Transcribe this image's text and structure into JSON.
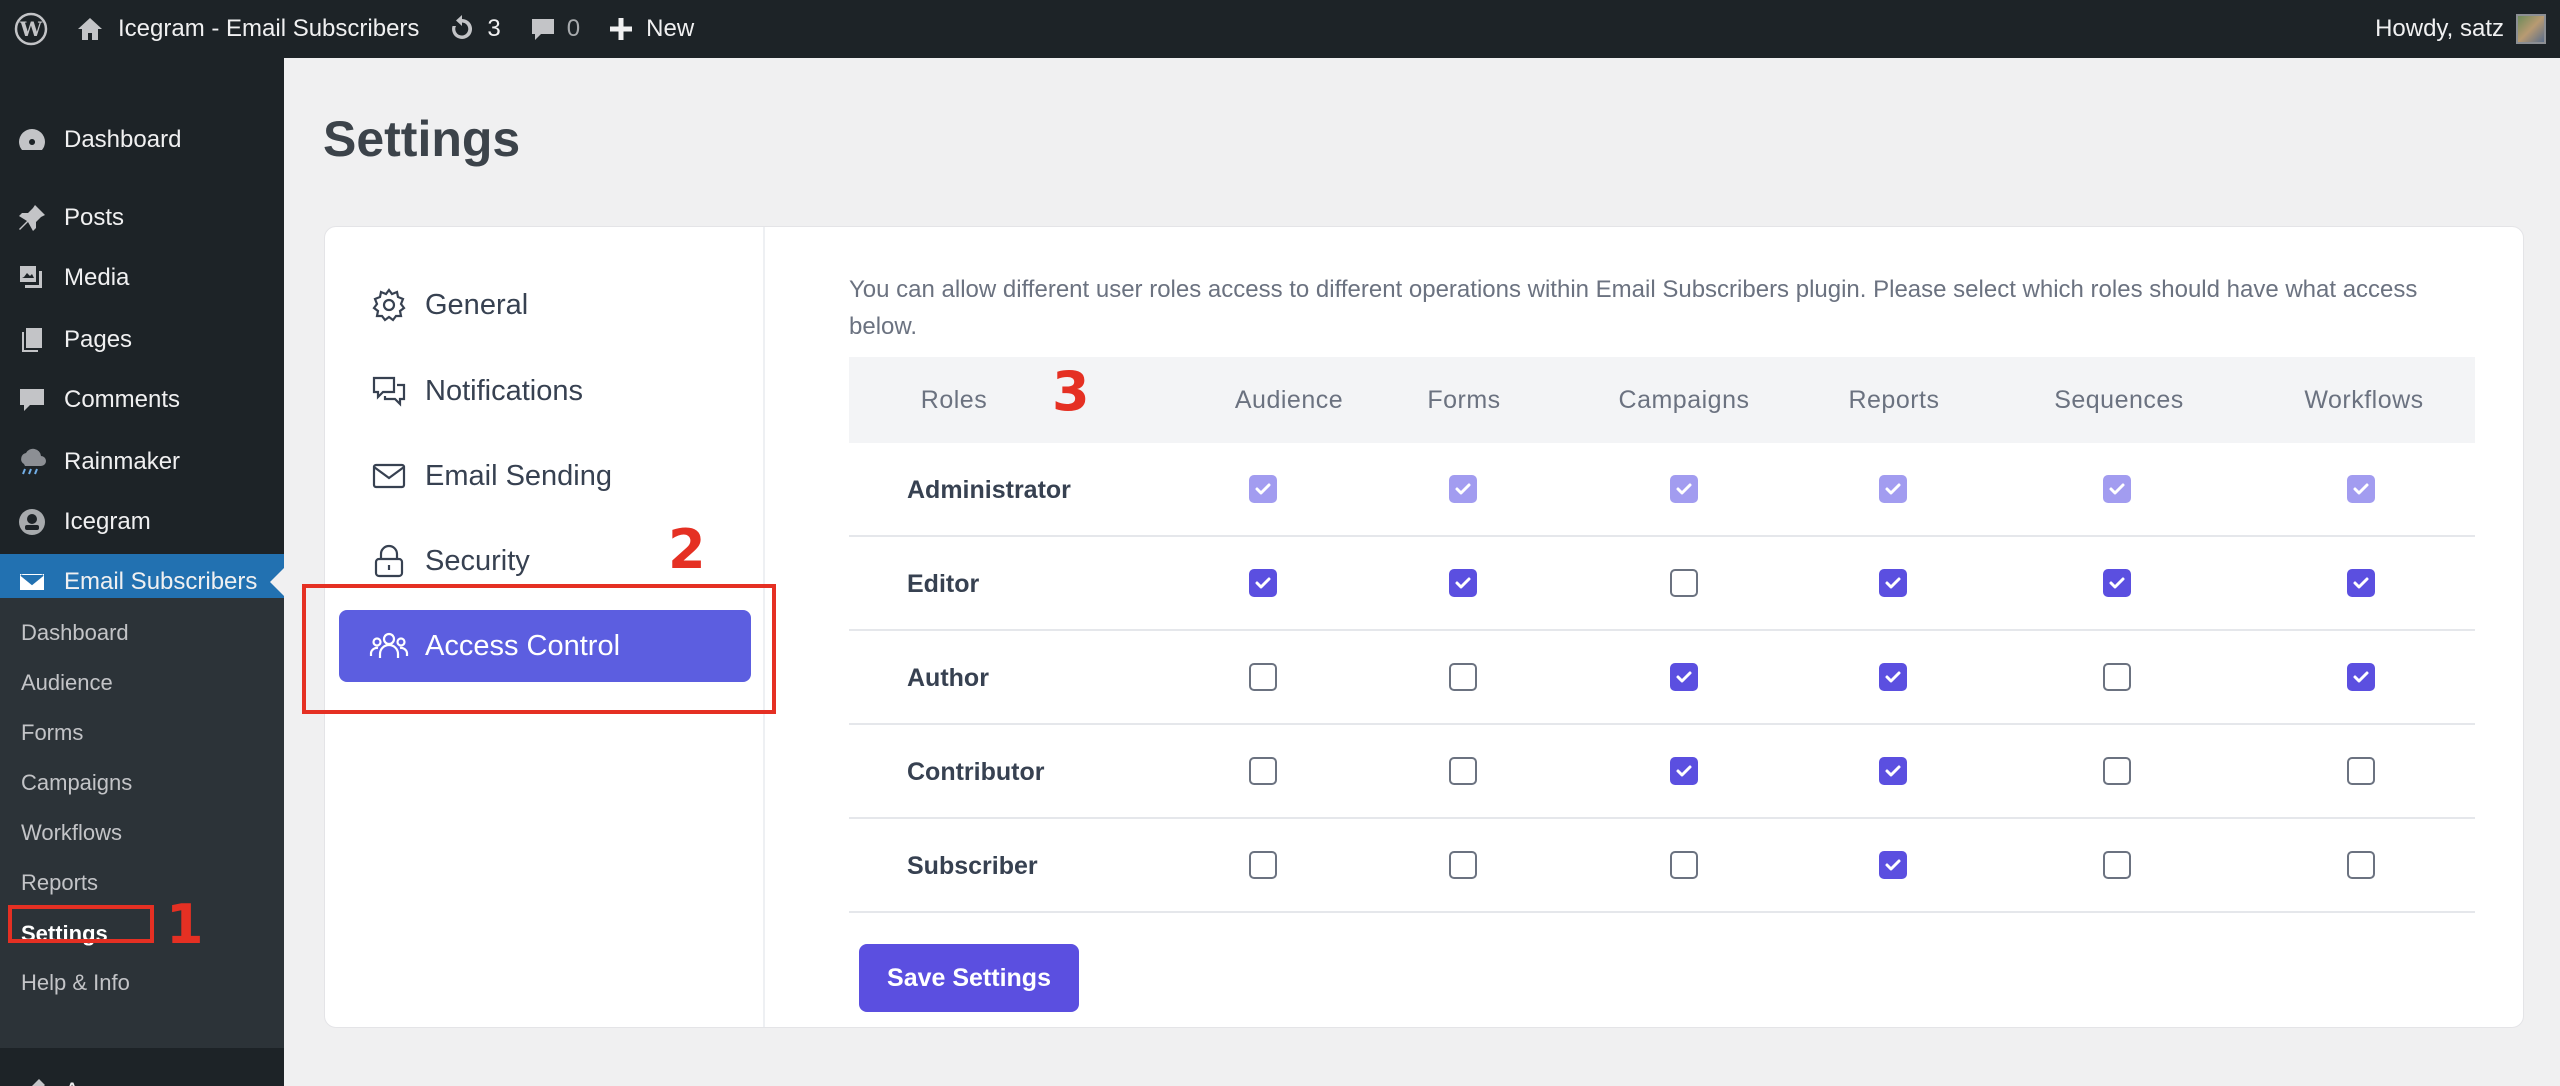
{
  "adminbar": {
    "site_name": "Icegram - Email Subscribers",
    "updates_count": "3",
    "comments_count": "0",
    "new_label": "New",
    "howdy": "Howdy, satz"
  },
  "sidebar": {
    "items": [
      {
        "label": "Dashboard",
        "icon": "dashboard-icon"
      },
      {
        "label": "Posts",
        "icon": "pin-icon"
      },
      {
        "label": "Media",
        "icon": "media-icon"
      },
      {
        "label": "Pages",
        "icon": "pages-icon"
      },
      {
        "label": "Comments",
        "icon": "comment-icon"
      },
      {
        "label": "Rainmaker",
        "icon": "cloud-icon"
      },
      {
        "label": "Icegram",
        "icon": "icegram-icon"
      },
      {
        "label": "Email Subscribers",
        "icon": "envelope-icon"
      }
    ],
    "submenu": [
      "Dashboard",
      "Audience",
      "Forms",
      "Campaigns",
      "Workflows",
      "Reports",
      "Settings",
      "Help & Info"
    ],
    "appearance": "Appearance"
  },
  "page": {
    "title": "Settings"
  },
  "settings_nav": [
    {
      "label": "General",
      "icon": "gear-icon"
    },
    {
      "label": "Notifications",
      "icon": "chat-bubbles-icon"
    },
    {
      "label": "Email Sending",
      "icon": "envelope-icon"
    },
    {
      "label": "Security",
      "icon": "lock-icon"
    },
    {
      "label": "Access Control",
      "icon": "users-icon"
    }
  ],
  "access": {
    "description": "You can allow different user roles access to different operations within Email Subscribers plugin. Please select which roles should have what access below.",
    "columns": [
      "Roles",
      "Audience",
      "Forms",
      "Campaigns",
      "Reports",
      "Sequences",
      "Workflows"
    ],
    "rows": [
      {
        "role": "Administrator",
        "checks": [
          true,
          true,
          true,
          true,
          true,
          true
        ],
        "disabled": true
      },
      {
        "role": "Editor",
        "checks": [
          true,
          true,
          false,
          true,
          true,
          true
        ],
        "disabled": false
      },
      {
        "role": "Author",
        "checks": [
          false,
          false,
          true,
          true,
          false,
          true
        ],
        "disabled": false
      },
      {
        "role": "Contributor",
        "checks": [
          false,
          false,
          true,
          true,
          false,
          false
        ],
        "disabled": false
      },
      {
        "role": "Subscriber",
        "checks": [
          false,
          false,
          false,
          true,
          false,
          false
        ],
        "disabled": false
      }
    ],
    "save_label": "Save Settings"
  },
  "annotations": [
    "1",
    "2",
    "3"
  ],
  "colors": {
    "accent": "#5b4fe0",
    "admin_bg": "#1d2327",
    "wp_blue": "#2271b1",
    "annotation_red": "#e53023"
  }
}
